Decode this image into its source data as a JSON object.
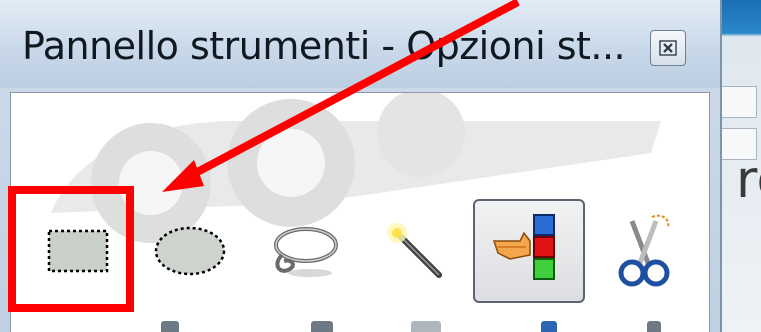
{
  "window": {
    "title": "Pannello strumenti - Opzioni st...",
    "close_label": "close"
  },
  "background": {
    "partial_text": "rg"
  },
  "toolbox": {
    "tools": [
      {
        "id": "rect-select",
        "icon": "rectangle-select-icon",
        "active": false
      },
      {
        "id": "ellipse-select",
        "icon": "ellipse-select-icon",
        "active": false
      },
      {
        "id": "free-select",
        "icon": "lasso-icon",
        "active": false
      },
      {
        "id": "fuzzy-select",
        "icon": "magic-wand-icon",
        "active": false
      },
      {
        "id": "select-by-color",
        "icon": "select-by-color-icon",
        "active": true
      },
      {
        "id": "scissors-select",
        "icon": "scissors-icon",
        "active": false
      }
    ]
  },
  "annotation": {
    "highlight_color": "#ff0000",
    "arrow_color": "#ff0000"
  },
  "colors": {
    "titlebar": "#c9d9ea",
    "client_bg": "#ffffff",
    "active_tool_border": "#5b6470"
  }
}
